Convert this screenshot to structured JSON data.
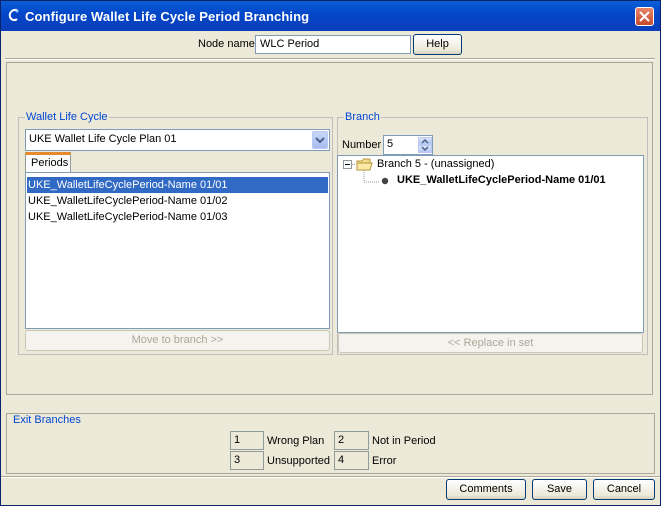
{
  "window": {
    "title": "Configure Wallet Life Cycle Period Branching",
    "close_icon": "close-icon",
    "app_icon": "node-icon"
  },
  "header": {
    "node_name_label": "Node name",
    "node_name_value": "WLC Period",
    "help_label": "Help"
  },
  "wallet_life_cycle": {
    "legend": "Wallet Life Cycle",
    "selected_plan": "UKE Wallet Life Cycle Plan 01",
    "tab_label": "Periods",
    "periods": [
      "UKE_WalletLifeCyclePeriod-Name 01/01",
      "UKE_WalletLifeCyclePeriod-Name 01/02",
      "UKE_WalletLifeCyclePeriod-Name 01/03"
    ],
    "move_button": "Move to branch >>"
  },
  "branch": {
    "legend": "Branch",
    "number_label": "Number",
    "number_value": "5",
    "tree_root": "Branch 5 - (unassigned)",
    "tree_child": "UKE_WalletLifeCyclePeriod-Name 01/01",
    "replace_button": "<< Replace in set"
  },
  "exit_branches": {
    "legend": "Exit Branches",
    "items": [
      {
        "num": "1",
        "label": "Wrong Plan"
      },
      {
        "num": "2",
        "label": "Not in Period"
      },
      {
        "num": "3",
        "label": "Unsupported"
      },
      {
        "num": "4",
        "label": "Error"
      }
    ]
  },
  "footer": {
    "comments": "Comments",
    "save": "Save",
    "cancel": "Cancel"
  },
  "colors": {
    "title_bar": "#0a4fd0",
    "legend_text": "#0046d5",
    "selection": "#316ac5",
    "window_bg": "#ece9d8"
  }
}
